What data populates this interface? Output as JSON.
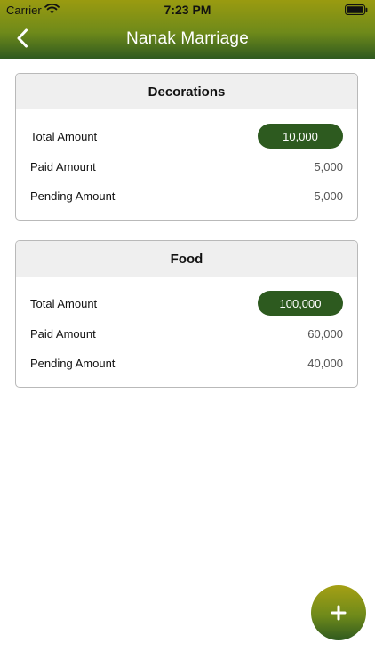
{
  "status_bar": {
    "carrier": "Carrier",
    "time": "7:23 PM",
    "wifi_icon": "wifi-icon",
    "battery_icon": "battery-icon"
  },
  "nav": {
    "title": "Nanak Marriage",
    "back_icon": "chevron-left-icon"
  },
  "colors": {
    "accent_dark": "#2d5a1f",
    "accent_olive": "#9a9b10"
  },
  "cards": [
    {
      "title": "Decorations",
      "rows": [
        {
          "label": "Total Amount",
          "value": "10,000"
        },
        {
          "label": "Paid Amount",
          "value": "5,000"
        },
        {
          "label": "Pending Amount",
          "value": "5,000"
        }
      ]
    },
    {
      "title": "Food",
      "rows": [
        {
          "label": "Total Amount",
          "value": "100,000"
        },
        {
          "label": "Paid Amount",
          "value": "60,000"
        },
        {
          "label": "Pending Amount",
          "value": "40,000"
        }
      ]
    }
  ],
  "fab": {
    "icon": "plus-icon"
  }
}
